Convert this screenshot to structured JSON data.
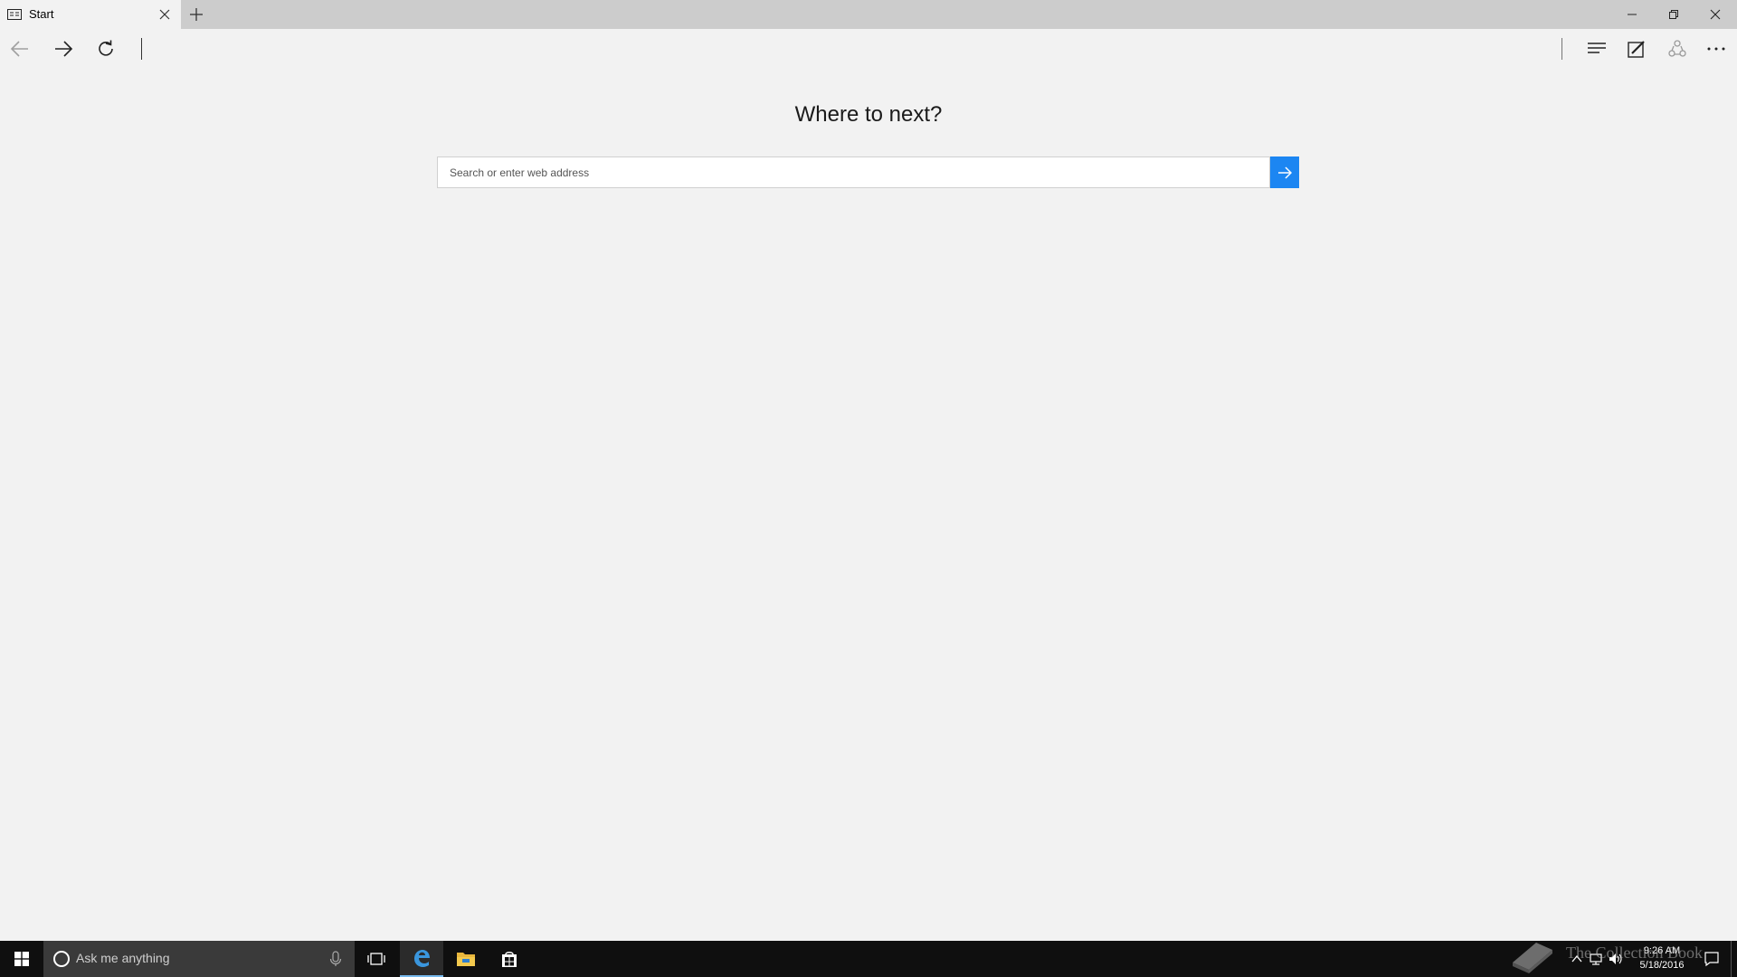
{
  "browser": {
    "tab": {
      "title": "Start",
      "favicon": "reading-view-icon"
    },
    "new_tab_icon": "plus-icon",
    "window_controls": [
      "minimize-icon",
      "restore-icon",
      "close-icon"
    ]
  },
  "navbar": {
    "buttons": [
      "back-arrow-icon",
      "forward-arrow-icon",
      "refresh-icon"
    ],
    "right_buttons": [
      "hub-icon",
      "web-note-icon",
      "share-icon",
      "more-icon"
    ]
  },
  "start_page": {
    "heading": "Where to next?",
    "search": {
      "placeholder": "Search or enter web address",
      "value": ""
    },
    "accent_color": "#1c86f2"
  },
  "taskbar": {
    "search_text": "Ask me anything",
    "pinned": [
      "task-view-icon",
      "edge-icon",
      "file-explorer-icon",
      "store-icon"
    ],
    "active_app": "edge-icon",
    "clock": {
      "time": "9:26 AM",
      "date": "5/18/2016"
    },
    "watermark": "The Collection Book"
  }
}
